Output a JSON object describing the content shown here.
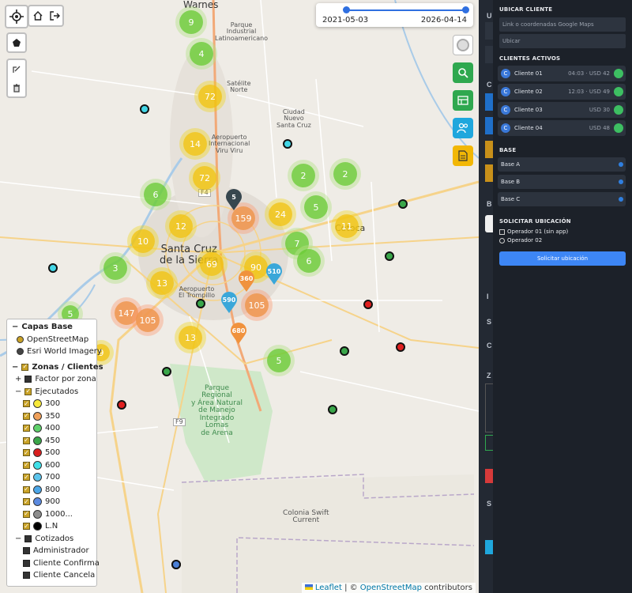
{
  "time_range": {
    "start": "2021-05-03",
    "end": "2026-04-14"
  },
  "attribution": {
    "leaflet": "Leaflet",
    "sep": " | © ",
    "osm": "OpenStreetMap",
    "suffix": " contributors"
  },
  "map_labels": {
    "warnes": "Warnes",
    "parque_industrial": "Parque\nIndustrial\nLatinoamericano",
    "satelite_norte": "Satélite\nNorte",
    "aeropuerto_viru": "Aeropuerto\nInternacional\nViru Viru",
    "ciudad_santa_cruz": "Ciudad\nNuevo\nSanta Cruz",
    "santa_cruz": "Santa Cruz\nde la Sierra",
    "cotoca": "Cotoca",
    "aeropuerto_trompillo": "Aeropuerto\nEl Trompillo",
    "parque_regional": "Parque\nRegional\ny Área Natural\nde Manejo\nIntegrado\nLomas\nde Arena",
    "colonia_swift": "Colonia Swift\nCurrent",
    "f4": "F4",
    "f9": "F9"
  },
  "clusters": [
    {
      "value": "9",
      "color": "green"
    },
    {
      "value": "4",
      "color": "green"
    },
    {
      "value": "72",
      "color": "yellow"
    },
    {
      "value": "14",
      "color": "yellow"
    },
    {
      "value": "72",
      "color": "yellow"
    },
    {
      "value": "6",
      "color": "green"
    },
    {
      "value": "12",
      "color": "yellow"
    },
    {
      "value": "159",
      "color": "orange"
    },
    {
      "value": "10",
      "color": "yellow"
    },
    {
      "value": "3",
      "color": "green"
    },
    {
      "value": "69",
      "color": "yellow"
    },
    {
      "value": "13",
      "color": "yellow"
    },
    {
      "value": "24",
      "color": "yellow"
    },
    {
      "value": "2",
      "color": "green"
    },
    {
      "value": "2",
      "color": "green"
    },
    {
      "value": "5",
      "color": "green"
    },
    {
      "value": "11",
      "color": "yellow"
    },
    {
      "value": "7",
      "color": "green"
    },
    {
      "value": "6",
      "color": "green"
    },
    {
      "value": "90",
      "color": "yellow"
    },
    {
      "value": "105",
      "color": "orange"
    },
    {
      "value": "147",
      "color": "orange"
    },
    {
      "value": "105",
      "color": "orange"
    },
    {
      "value": "13",
      "color": "yellow"
    },
    {
      "value": "5",
      "color": "green"
    },
    {
      "value": "5",
      "color": "green"
    },
    {
      "value": "9",
      "color": "yellow"
    }
  ],
  "pins": [
    {
      "value": "5",
      "color": "#37474f"
    },
    {
      "value": "360",
      "color": "#f0923d"
    },
    {
      "value": "510",
      "color": "#3aa7d9"
    },
    {
      "value": "590",
      "color": "#3aa7d9"
    },
    {
      "value": "680",
      "color": "#f0923d"
    }
  ],
  "point_colors": [
    "#43d6e6",
    "#43d6e6",
    "#43d6e6",
    "#3aa64a",
    "#3aa64a",
    "#3aa64a",
    "#3aa64a",
    "#3aa64a",
    "#3aa64a",
    "#e02020",
    "#e02020",
    "#e02020",
    "#e02020",
    "#4a7fd6"
  ],
  "legend": {
    "capas_base": "Capas Base",
    "osm": "OpenStreetMap",
    "esri": "Esri World Imagery",
    "zonas": "Zonas / Clientes",
    "factor": "Factor por zona",
    "ejecutados": "Ejecutados",
    "items": [
      {
        "label": "300",
        "color": "#f7e93a"
      },
      {
        "label": "350",
        "color": "#f0a05a"
      },
      {
        "label": "400",
        "color": "#5fd16b"
      },
      {
        "label": "450",
        "color": "#3aa64a"
      },
      {
        "label": "500",
        "color": "#d91e1e"
      },
      {
        "label": "600",
        "color": "#3fe0e8"
      },
      {
        "label": "700",
        "color": "#5cc4ec"
      },
      {
        "label": "800",
        "color": "#4ba6e8"
      },
      {
        "label": "900",
        "color": "#5b8ae0"
      },
      {
        "label": "1000...",
        "color": "#8d8d8d"
      },
      {
        "label": "L.N",
        "color": "#000000"
      }
    ],
    "cotizados": "Cotizados",
    "administrador": "Administrador",
    "cliente_confirma": "Cliente Confirma",
    "cliente_cancela": "Cliente Cancela"
  },
  "panel": {
    "ubicar_title": "UBICAR CLIENTE",
    "link_placeholder": "Link o coordenadas Google Maps",
    "ubicar_btn": "Ubicar",
    "activos_title": "CLIENTES ACTIVOS",
    "clientes": [
      {
        "name": "Cliente 01",
        "info": "04:03 · USD 42"
      },
      {
        "name": "Cliente 02",
        "info": "12:03 · USD 49"
      },
      {
        "name": "Cliente 03",
        "info": "USD 30"
      },
      {
        "name": "Cliente 04",
        "info": "USD 48"
      }
    ],
    "base_title": "BASE",
    "bases": [
      "Base A",
      "Base B",
      "Base C"
    ],
    "solicitar_title": "SOLICITAR UBICACIÓN",
    "operador1": "Operador 01 (sin app)",
    "operador2": "Operador 02",
    "solicitar_btn": "Solicitar ubicación"
  },
  "strip_letters": [
    "U",
    "C",
    "B",
    "I",
    "S",
    "C",
    "Z",
    "S"
  ]
}
